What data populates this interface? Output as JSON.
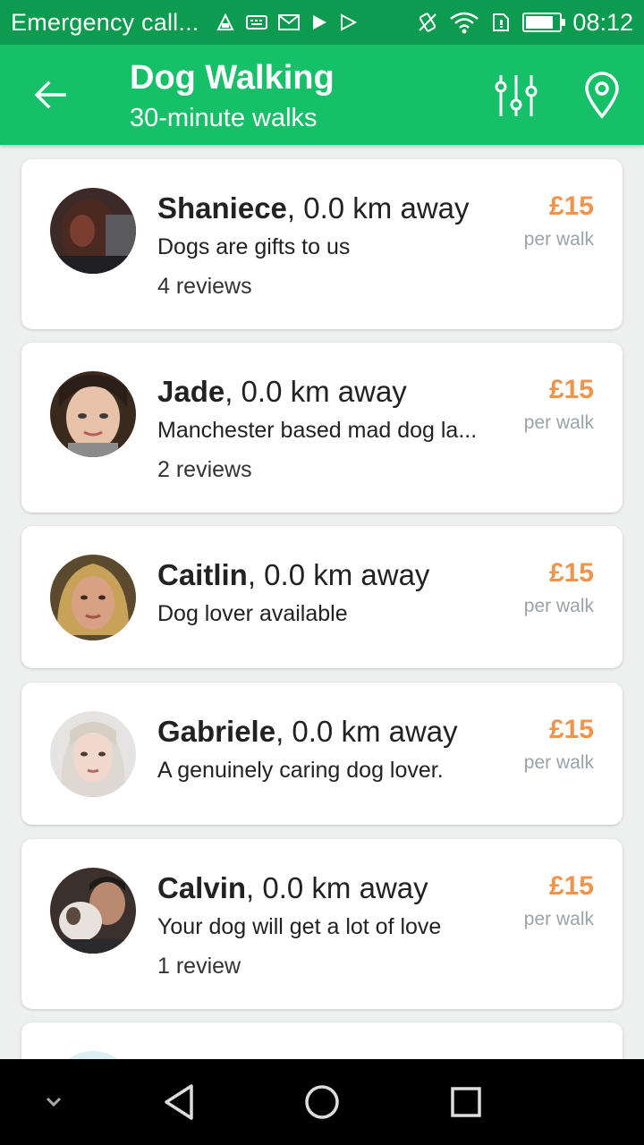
{
  "status_bar": {
    "carrier": "Emergency call...",
    "time": "08:12",
    "battery_level": 0.82,
    "notification_icons": [
      "alarm-icon",
      "keyboard-icon",
      "gmail-icon",
      "play-store-icon",
      "play-store-outline-icon"
    ],
    "right_icons": [
      "vibrate-icon",
      "wifi-icon",
      "sim-icon",
      "battery-icon"
    ]
  },
  "appbar": {
    "title": "Dog Walking",
    "subtitle": "30-minute walks",
    "back_icon": "arrow-left-icon",
    "filter_icon": "sliders-icon",
    "location_icon": "map-pin-icon"
  },
  "colors": {
    "status_bar": "#0d9b4f",
    "app_bar": "#16c068",
    "price": "#f0934b",
    "per_walk": "#9aa3a8"
  },
  "walkers": [
    {
      "name": "Shaniece",
      "distance": ", 0.0 km away",
      "bio": "Dogs are gifts to us",
      "reviews": "4 reviews",
      "price": "£15",
      "per": "per walk"
    },
    {
      "name": "Jade",
      "distance": ", 0.0 km away",
      "bio": "Manchester based mad dog la...",
      "reviews": "2 reviews",
      "price": "£15",
      "per": "per walk"
    },
    {
      "name": "Caitlin",
      "distance": ", 0.0 km away",
      "bio": "Dog lover available",
      "reviews": "",
      "price": "£15",
      "per": "per walk"
    },
    {
      "name": "Gabriele",
      "distance": ", 0.0 km away",
      "bio": "A genuinely caring dog lover.",
      "reviews": "",
      "price": "£15",
      "per": "per walk"
    },
    {
      "name": "Calvin",
      "distance": ", 0.0 km away",
      "bio": "Your dog will get a lot of love",
      "reviews": "1 review",
      "price": "£15",
      "per": "per walk"
    }
  ],
  "navbar": {
    "icons": [
      "chevron-down-icon",
      "back-triangle-icon",
      "home-circle-icon",
      "recents-square-icon"
    ]
  }
}
